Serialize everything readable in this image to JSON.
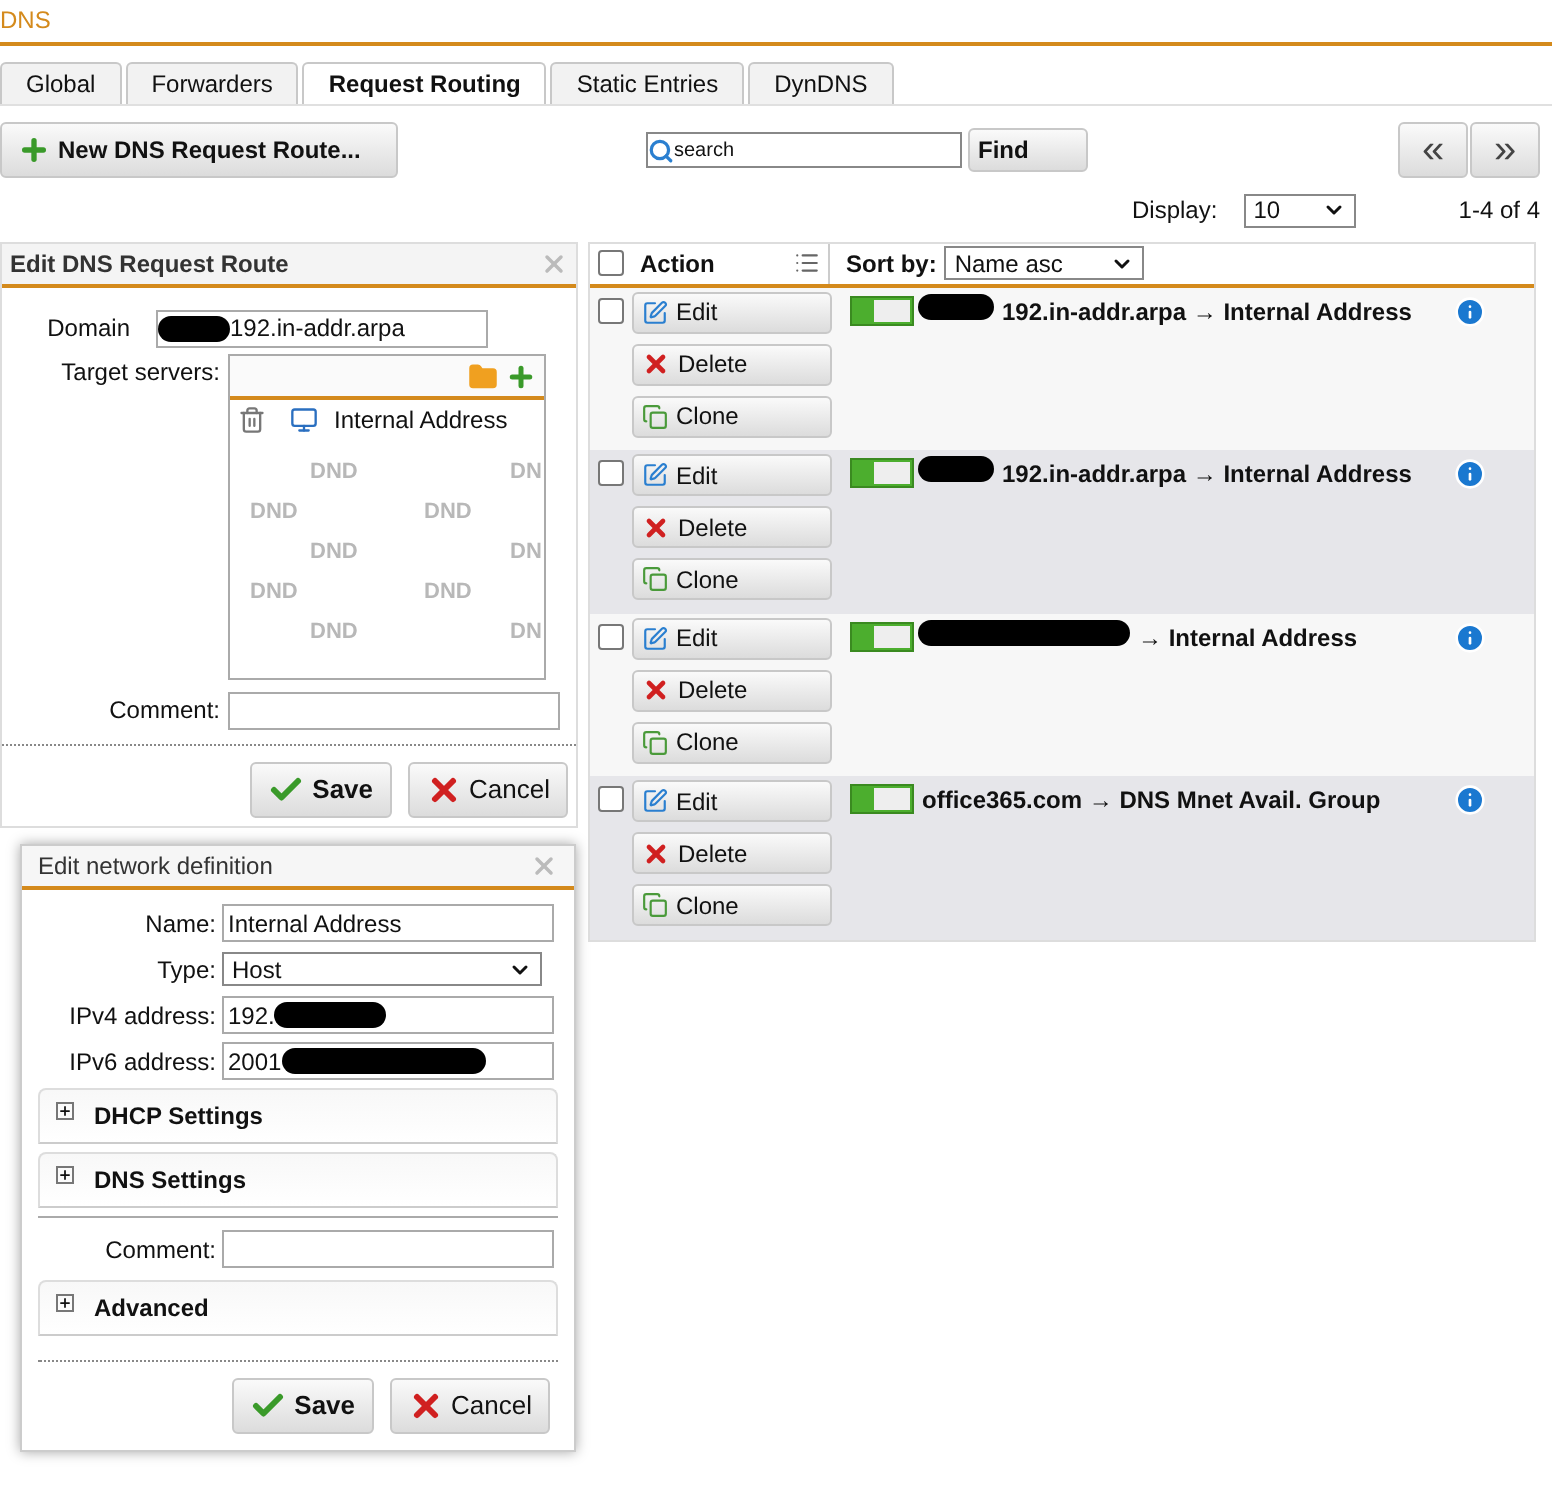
{
  "header": {
    "title": "DNS"
  },
  "tabs": [
    {
      "label": "Global",
      "selected": false
    },
    {
      "label": "Forwarders",
      "selected": false
    },
    {
      "label": "Request Routing",
      "selected": true
    },
    {
      "label": "Static Entries",
      "selected": false
    },
    {
      "label": "DynDNS",
      "selected": false
    }
  ],
  "toolbar": {
    "new_button": "New DNS Request Route...",
    "search": {
      "value": "search"
    },
    "find_button": "Find",
    "prev_button": "«",
    "next_button": "»"
  },
  "display": {
    "label": "Display:",
    "value": "10",
    "count": "1-4 of 4"
  },
  "route_editor": {
    "title": "Edit DNS Request Route",
    "domain_label": "Domain",
    "domain_value": "192.in-addr.arpa",
    "domain_redacted": true,
    "target_label": "Target servers:",
    "targets": [
      {
        "name": "Internal Address"
      }
    ],
    "watermarks": [
      "DND",
      "DN",
      "DND",
      "DND",
      "DND",
      "DN",
      "DND",
      "DND",
      "DND",
      "DN"
    ],
    "comment_label": "Comment:",
    "save": "Save",
    "cancel": "Cancel"
  },
  "table": {
    "all_checked": false,
    "action_header": "Action",
    "sort_label": "Sort by:",
    "sort_value": "Name asc",
    "rows": [
      {
        "checked": false,
        "edit": "Edit",
        "delete": "Delete",
        "clone": "Clone",
        "enabled": true,
        "redacted": true,
        "name": "192.in-addr.arpa → Internal Address"
      },
      {
        "checked": false,
        "edit": "Edit",
        "delete": "Delete",
        "clone": "Clone",
        "enabled": true,
        "redacted": true,
        "name": "192.in-addr.arpa → Internal Address"
      },
      {
        "checked": false,
        "edit": "Edit",
        "delete": "Delete",
        "clone": "Clone",
        "enabled": true,
        "redacted": true,
        "name": "→ Internal Address"
      },
      {
        "checked": false,
        "edit": "Edit",
        "delete": "Delete",
        "clone": "Clone",
        "enabled": true,
        "redacted": false,
        "name": "office365.com → DNS Mnet Avail. Group"
      }
    ]
  },
  "network_editor": {
    "title": "Edit network definition",
    "fields": [
      {
        "kind": "text",
        "label": "Name:",
        "value": "Internal Address",
        "redacted": false
      },
      {
        "kind": "select",
        "label": "Type:",
        "value": "Host",
        "redacted": false
      },
      {
        "kind": "text",
        "label": "IPv4 address:",
        "value": "192.",
        "redacted": true
      },
      {
        "kind": "text",
        "label": "IPv6 address:",
        "value": "2001",
        "redacted": true
      }
    ],
    "sections": [
      {
        "kind": "section",
        "title": "DHCP Settings",
        "expanded": false
      },
      {
        "kind": "section",
        "title": "DNS Settings",
        "expanded": false
      },
      {
        "kind": "comment",
        "title": "Comment:"
      },
      {
        "kind": "section",
        "title": "Advanced",
        "expanded": false
      }
    ],
    "save": "Save",
    "cancel": "Cancel"
  }
}
